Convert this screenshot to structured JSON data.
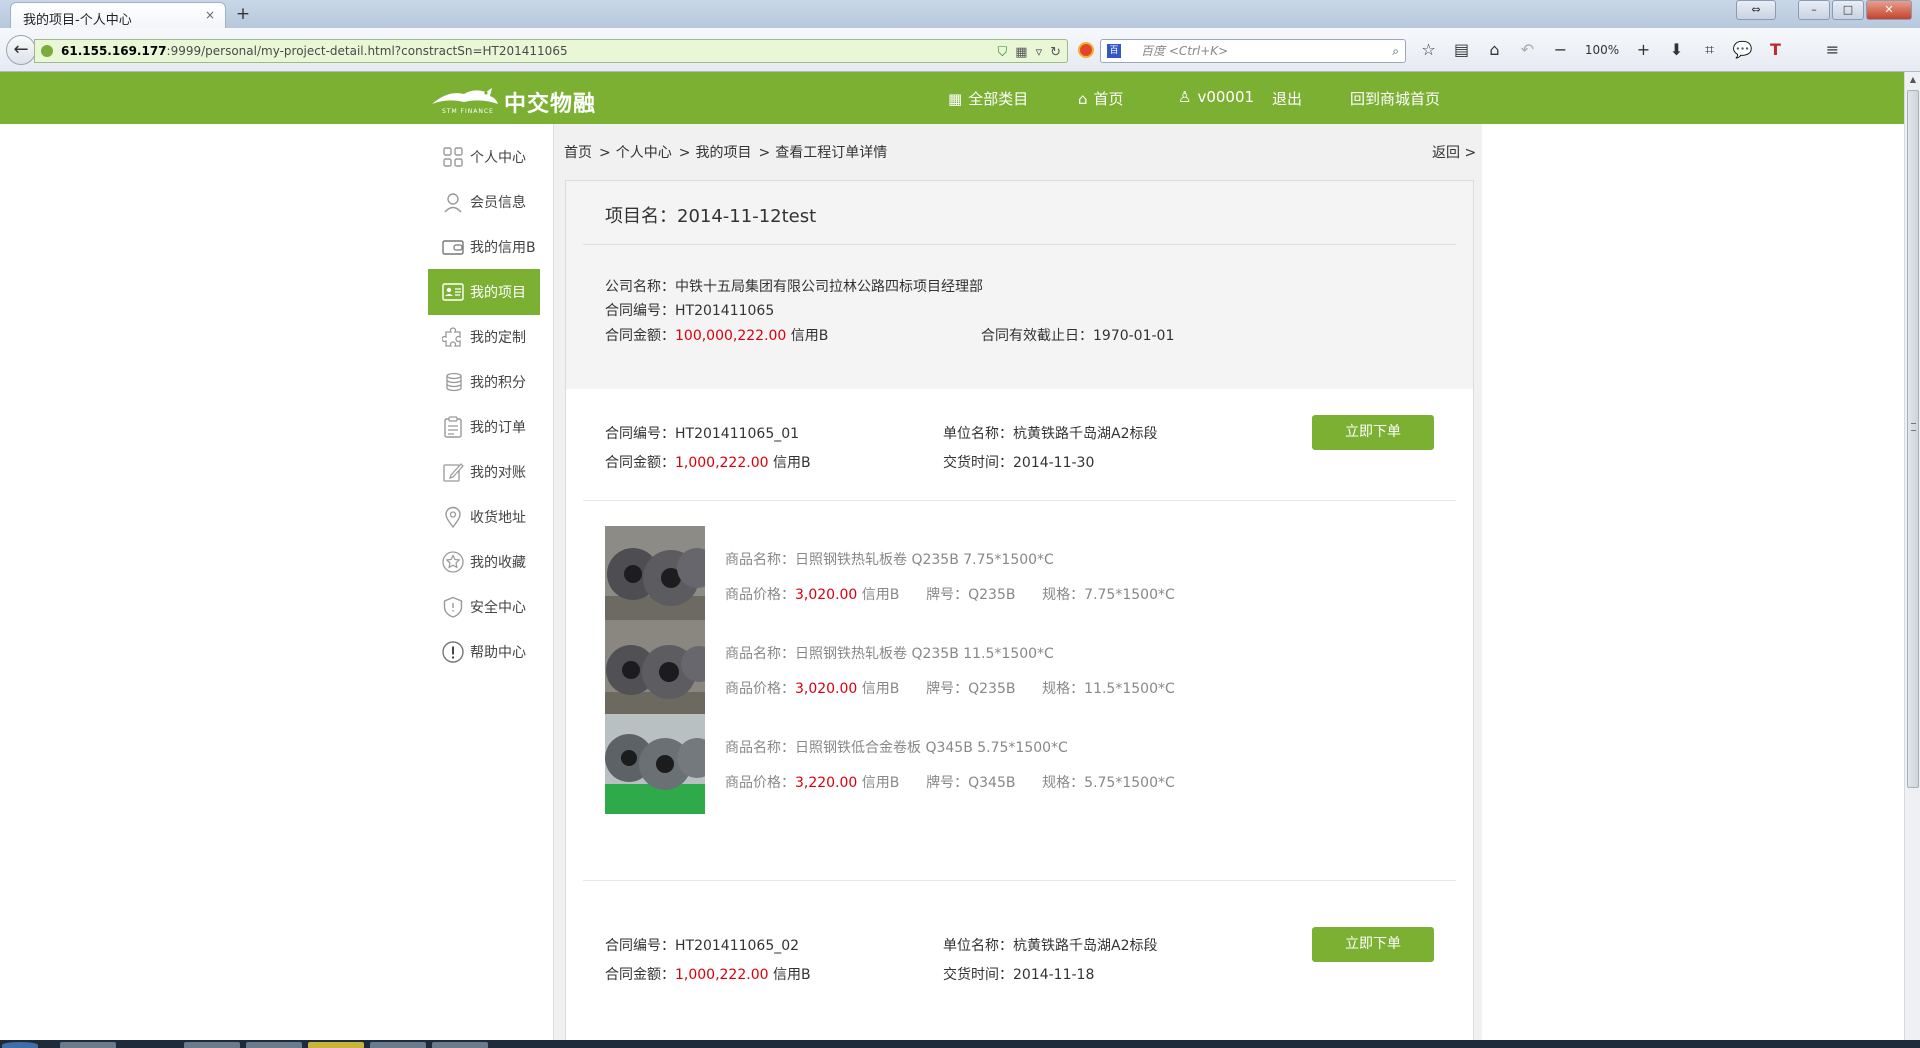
{
  "browser": {
    "tab_title": "我的项目-个人中心",
    "tab_close": "×",
    "new_tab": "+",
    "url_host": "61.155.169.177",
    "url_path": ":9999/personal/my-project-detail.html?constractSn=HT201411065",
    "search_placeholder": "百度 <Ctrl+K>",
    "search_engine": "百",
    "zoom": "100%"
  },
  "header": {
    "logo_text": "中交物融",
    "logo_sub": "STM FINANCE",
    "categories": "全部类目",
    "home": "首页",
    "user": "v00001",
    "logout": "退出",
    "mall_home": "回到商城首页"
  },
  "sidebar": {
    "items": [
      {
        "label": "个人中心",
        "icon": "grid-icon"
      },
      {
        "label": "会员信息",
        "icon": "user-icon"
      },
      {
        "label": "我的信用B",
        "icon": "wallet-icon"
      },
      {
        "label": "我的项目",
        "icon": "id-card-icon"
      },
      {
        "label": "我的定制",
        "icon": "puzzle-icon"
      },
      {
        "label": "我的积分",
        "icon": "coins-icon"
      },
      {
        "label": "我的订单",
        "icon": "clipboard-icon"
      },
      {
        "label": "我的对账",
        "icon": "edit-icon"
      },
      {
        "label": "收货地址",
        "icon": "location-icon"
      },
      {
        "label": "我的收藏",
        "icon": "star-icon"
      },
      {
        "label": "安全中心",
        "icon": "shield-icon"
      },
      {
        "label": "帮助中心",
        "icon": "alert-icon"
      }
    ],
    "active_index": 3
  },
  "breadcrumb": {
    "items": [
      "首页",
      "个人中心",
      "我的项目",
      "查看工程订单详情"
    ],
    "separator": ">",
    "back": "返回 >"
  },
  "project": {
    "title_label": "项目名：",
    "title": "2014-11-12test",
    "company_label": "公司名称：",
    "company": "中铁十五局集团有限公司拉林公路四标项目经理部",
    "contract_no_label": "合同编号：",
    "contract_no": "HT201411065",
    "amount_label": "合同金额：",
    "amount": "100,000,222.00",
    "amount_unit": "信用B",
    "expiry_label": "合同有效截止日：",
    "expiry": "1970-01-01"
  },
  "contracts": [
    {
      "no_label": "合同编号：",
      "no": "HT201411065_01",
      "unit_label": "单位名称：",
      "unit": "杭黄铁路千岛湖A2标段",
      "amount_label": "合同金额：",
      "amount": "1,000,222.00",
      "amount_unit": "信用B",
      "delivery_label": "交货时间：",
      "delivery": "2014-11-30",
      "button": "立即下单",
      "products": [
        {
          "name_label": "商品名称：",
          "name": "日照钢铁热轧板卷 Q235B 7.75*1500*C",
          "price_label": "商品价格：",
          "price": "3,020.00",
          "price_unit": "信用B",
          "brand": "牌号：Q235B",
          "spec": "规格：7.75*1500*C"
        },
        {
          "name_label": "商品名称：",
          "name": "日照钢铁热轧板卷 Q235B 11.5*1500*C",
          "price_label": "商品价格：",
          "price": "3,020.00",
          "price_unit": "信用B",
          "brand": "牌号：Q235B",
          "spec": "规格：11.5*1500*C"
        },
        {
          "name_label": "商品名称：",
          "name": "日照钢铁低合金卷板 Q345B 5.75*1500*C",
          "price_label": "商品价格：",
          "price": "3,220.00",
          "price_unit": "信用B",
          "brand": "牌号：Q345B",
          "spec": "规格：5.75*1500*C"
        }
      ]
    },
    {
      "no_label": "合同编号：",
      "no": "HT201411065_02",
      "unit_label": "单位名称：",
      "unit": "杭黄铁路千岛湖A2标段",
      "amount_label": "合同金额：",
      "amount": "1,000,222.00",
      "amount_unit": "信用B",
      "delivery_label": "交货时间：",
      "delivery": "2014-11-18",
      "button": "立即下单"
    }
  ],
  "colors": {
    "brand_green": "#7cb033",
    "price_red": "#d8000c"
  }
}
